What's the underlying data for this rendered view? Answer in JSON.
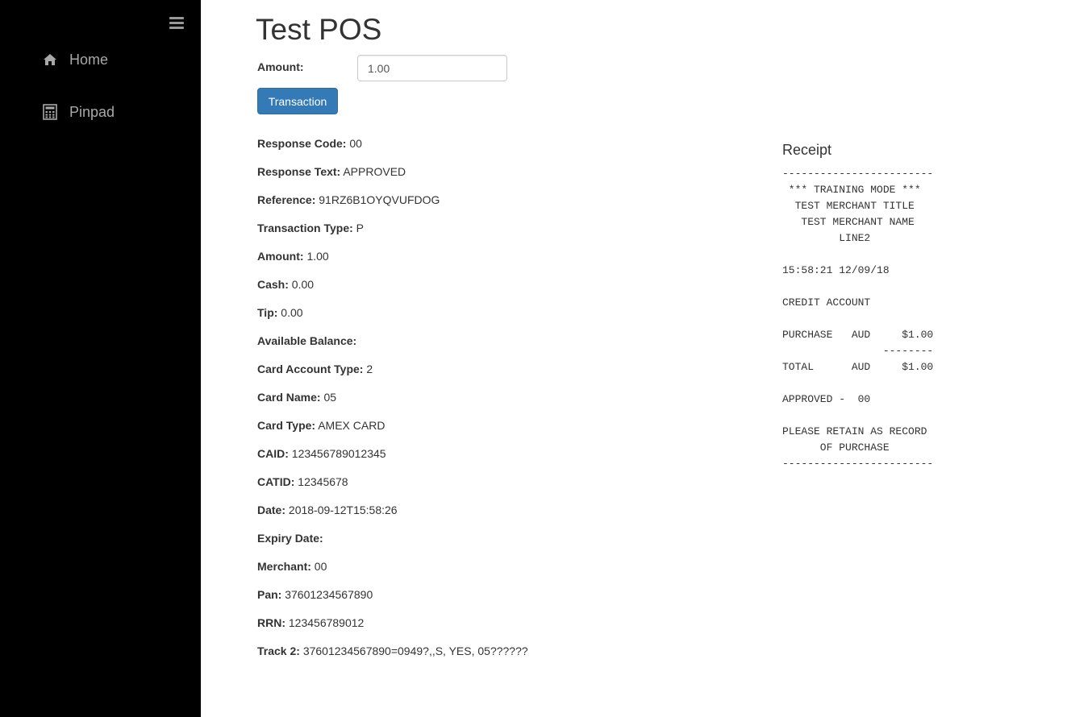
{
  "sidebar": {
    "toggle_icon": "hamburger-menu-icon",
    "items": [
      {
        "label": "Home",
        "icon": "home-icon"
      },
      {
        "label": "Pinpad",
        "icon": "calculator-icon"
      }
    ],
    "colors": {
      "background": "#000000",
      "text": "#a8a8a8"
    }
  },
  "header": {
    "title": "Test POS"
  },
  "form": {
    "amount_label": "Amount:",
    "amount_value": "1.00",
    "transaction_button": "Transaction",
    "button_color": "#337ab7"
  },
  "fields": [
    {
      "label": "Response Code:",
      "value": "00"
    },
    {
      "label": "Response Text:",
      "value": "APPROVED"
    },
    {
      "label": "Reference:",
      "value": "91RZ6B1OYQVUFDOG"
    },
    {
      "label": "Transaction Type:",
      "value": "P"
    },
    {
      "label": "Amount:",
      "value": "1.00"
    },
    {
      "label": "Cash:",
      "value": "0.00"
    },
    {
      "label": "Tip:",
      "value": "0.00"
    },
    {
      "label": "Available Balance:",
      "value": ""
    },
    {
      "label": "Card Account Type:",
      "value": "2"
    },
    {
      "label": "Card Name:",
      "value": "05"
    },
    {
      "label": "Card Type:",
      "value": "AMEX CARD"
    },
    {
      "label": "CAID:",
      "value": "123456789012345"
    },
    {
      "label": "CATID:",
      "value": "12345678"
    },
    {
      "label": "Date:",
      "value": "2018-09-12T15:58:26"
    },
    {
      "label": "Expiry Date:",
      "value": ""
    },
    {
      "label": "Merchant:",
      "value": "00"
    },
    {
      "label": "Pan:",
      "value": "37601234567890"
    },
    {
      "label": "RRN:",
      "value": "123456789012"
    },
    {
      "label": "Track 2:",
      "value": "37601234567890=0949?,,S, YES, 05??????"
    }
  ],
  "receipt": {
    "title": "Receipt",
    "text": "------------------------\n *** TRAINING MODE ***\n  TEST MERCHANT TITLE\n   TEST MERCHANT NAME\n         LINE2\n\n15:58:21 12/09/18\n\nCREDIT ACCOUNT\n\nPURCHASE   AUD     $1.00\n                --------\nTOTAL      AUD     $1.00\n\nAPPROVED -  00\n\nPLEASE RETAIN AS RECORD\n      OF PURCHASE\n------------------------"
  }
}
